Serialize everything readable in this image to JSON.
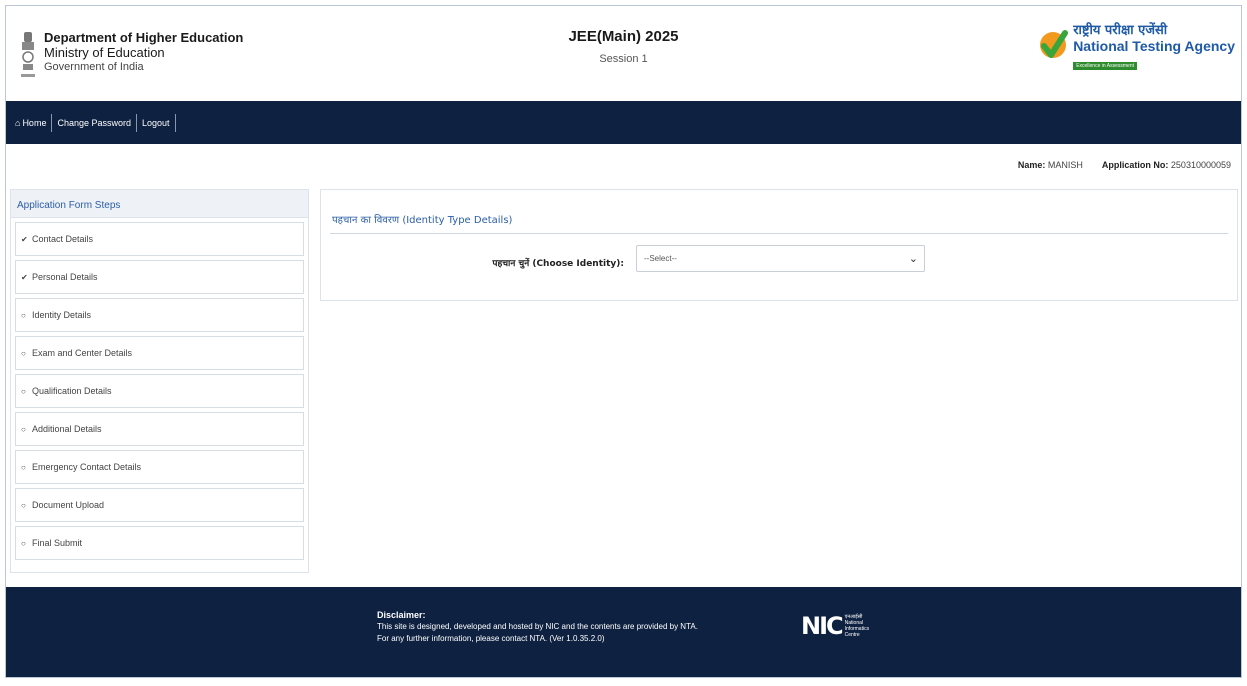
{
  "header": {
    "dept_line1": "Department of Higher Education",
    "dept_line2": "Ministry of Education",
    "dept_line3": "Government of India",
    "title": "JEE(Main) 2025",
    "subtitle": "Session 1",
    "nta_hindi": "राष्ट्रीय परीक्षा एजेंसी",
    "nta_english": "National Testing Agency",
    "nta_tagline": "Excellence in Assessment"
  },
  "nav": {
    "home": "Home",
    "change_password": "Change Password",
    "logout": "Logout"
  },
  "userinfo": {
    "name_label": "Name:",
    "name_value": "MANISH",
    "appno_label": "Application No:",
    "appno_value": "250310000059"
  },
  "sidebar": {
    "heading": "Application Form Steps",
    "steps": [
      {
        "label": "Contact Details",
        "status": "done"
      },
      {
        "label": "Personal Details",
        "status": "done"
      },
      {
        "label": "Identity Details",
        "status": "pending"
      },
      {
        "label": "Exam and Center Details",
        "status": "pending"
      },
      {
        "label": "Qualification Details",
        "status": "pending"
      },
      {
        "label": "Additional Details",
        "status": "pending"
      },
      {
        "label": "Emergency Contact Details",
        "status": "pending"
      },
      {
        "label": "Document Upload",
        "status": "pending"
      },
      {
        "label": "Final Submit",
        "status": "pending"
      }
    ]
  },
  "panel": {
    "title": "पहचान का विवरण (Identity Type Details)",
    "field_label": "पहचान चुनें (Choose Identity):",
    "select_value": "--Select--"
  },
  "footer": {
    "disclaimer_title": "Disclaimer:",
    "disclaimer_text": "This site is designed, developed and hosted by NIC and the contents are provided by NTA. For any further information, please contact NTA. (Ver 1.0.35.2.0)",
    "nic_mark": "NIC",
    "nic_hindi": "एनआईसी",
    "nic_text1": "National",
    "nic_text2": "Informatics",
    "nic_text3": "Centre"
  },
  "colors": {
    "navy": "#0e2140",
    "link_blue": "#2b5ea8",
    "nta_blue": "#1f5aa6"
  }
}
